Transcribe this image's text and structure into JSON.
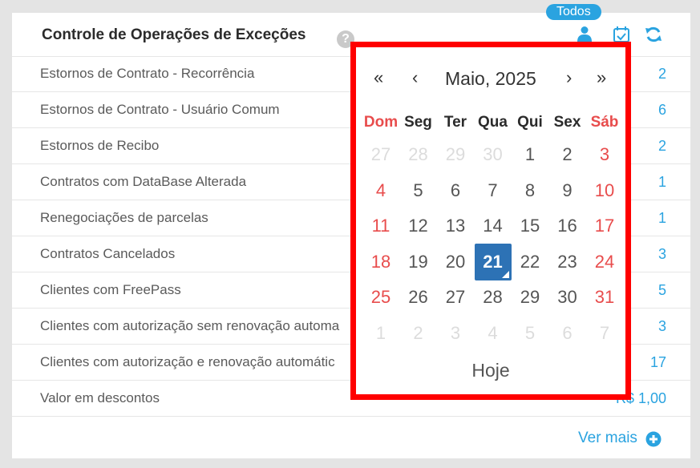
{
  "panel": {
    "title": "Controle de Operações de Exceções",
    "help": "?",
    "badge": "Todos",
    "footer_link": "Ver mais"
  },
  "rows": [
    {
      "label": "Estornos de Contrato - Recorrência",
      "value": "2"
    },
    {
      "label": "Estornos de Contrato - Usuário Comum",
      "value": "6"
    },
    {
      "label": "Estornos de Recibo",
      "value": "2"
    },
    {
      "label": "Contratos com DataBase Alterada",
      "value": "1"
    },
    {
      "label": "Renegociações de parcelas",
      "value": "1"
    },
    {
      "label": "Contratos Cancelados",
      "value": "3"
    },
    {
      "label": "Clientes com FreePass",
      "value": "5"
    },
    {
      "label": "Clientes com autorização sem renovação automa",
      "value": "3"
    },
    {
      "label": "Clientes com autorização e renovação automátic",
      "value": "17"
    },
    {
      "label": "Valor em descontos",
      "value": "R$ 1,00"
    }
  ],
  "datepicker": {
    "month_label": "Maio, 2025",
    "prev_year": "«",
    "prev_month": "‹",
    "next_month": "›",
    "next_year": "»",
    "weekdays": [
      "Dom",
      "Seg",
      "Ter",
      "Qua",
      "Qui",
      "Sex",
      "Sáb"
    ],
    "weeks": [
      [
        27,
        28,
        29,
        30,
        1,
        2,
        3
      ],
      [
        4,
        5,
        6,
        7,
        8,
        9,
        10
      ],
      [
        11,
        12,
        13,
        14,
        15,
        16,
        17
      ],
      [
        18,
        19,
        20,
        21,
        22,
        23,
        24
      ],
      [
        25,
        26,
        27,
        28,
        29,
        30,
        31
      ],
      [
        1,
        2,
        3,
        4,
        5,
        6,
        7
      ]
    ],
    "outside_month": [
      [
        0,
        0
      ],
      [
        0,
        1
      ],
      [
        0,
        2
      ],
      [
        0,
        3
      ],
      [
        5,
        0
      ],
      [
        5,
        1
      ],
      [
        5,
        2
      ],
      [
        5,
        3
      ],
      [
        5,
        4
      ],
      [
        5,
        5
      ],
      [
        5,
        6
      ]
    ],
    "selected_day": 21,
    "today_label": "Hoje"
  },
  "colors": {
    "accent": "#2aa3e0",
    "weekend": "#e84c4c",
    "selected": "#2d72b5",
    "highlight_border": "#ff0000"
  },
  "icons": [
    "help-icon",
    "user-icon",
    "calendar-check-icon",
    "refresh-icon",
    "plus-circle-icon"
  ]
}
